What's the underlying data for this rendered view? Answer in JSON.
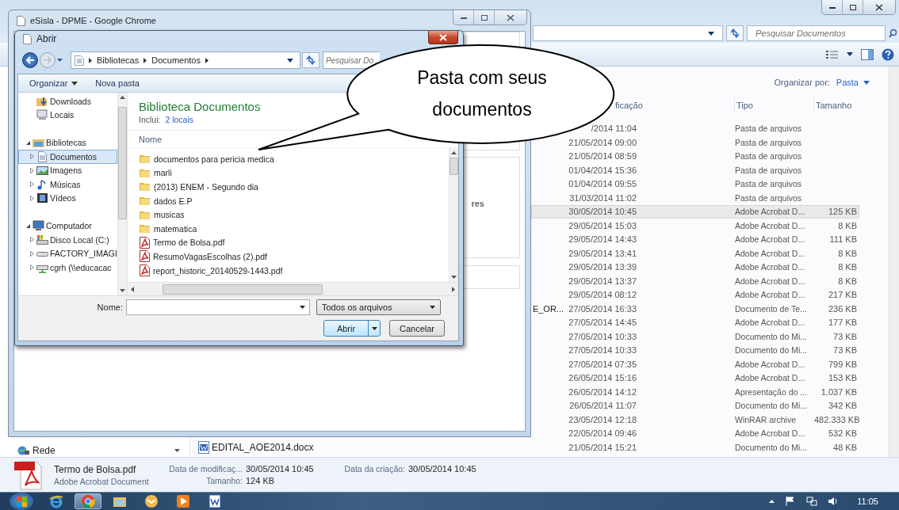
{
  "explorer": {
    "search": {
      "placeholder": "Pesquisar Documentos"
    },
    "arrange": {
      "label": "Organizar por:",
      "value": "Pasta"
    },
    "columns": [
      "ficação",
      "Tipo",
      "Tamanho"
    ],
    "rows": [
      {
        "date": "/2014 11:04",
        "type": "Pasta de arquivos",
        "selected": false
      },
      {
        "date": "21/05/2014 09:00",
        "type": "Pasta de arquivos",
        "selected": false
      },
      {
        "date": "21/05/2014 08:59",
        "type": "Pasta de arquivos",
        "selected": false
      },
      {
        "date": "01/04/2014 15:36",
        "type": "Pasta de arquivos",
        "selected": false
      },
      {
        "date": "01/04/2014 09:55",
        "type": "Pasta de arquivos",
        "selected": false
      },
      {
        "date": "31/03/2014 11:02",
        "type": "Pasta de arquivos",
        "selected": false
      },
      {
        "date": "30/05/2014 10:45",
        "type": "Adobe Acrobat D...",
        "size": "125 KB",
        "selected": true
      },
      {
        "date": "29/05/2014 15:03",
        "type": "Adobe Acrobat D...",
        "size": "8 KB",
        "selected": false
      },
      {
        "date": "29/05/2014 14:43",
        "type": "Adobe Acrobat D...",
        "size": "111 KB",
        "selected": false
      },
      {
        "date": "29/05/2014 13:41",
        "type": "Adobe Acrobat D...",
        "size": "8 KB",
        "selected": false
      },
      {
        "date": "29/05/2014 13:39",
        "type": "Adobe Acrobat D...",
        "size": "8 KB",
        "selected": false
      },
      {
        "date": "29/05/2014 13:37",
        "type": "Adobe Acrobat D...",
        "size": "8 KB",
        "selected": false
      },
      {
        "date": "29/05/2014 08:12",
        "type": "Adobe Acrobat D...",
        "size": "217 KB",
        "selected": false
      },
      {
        "name_tail": "E_OR...",
        "date": "27/05/2014 16:33",
        "type": "Documento de Te...",
        "size": "236 KB",
        "selected": false
      },
      {
        "date": "27/05/2014 14:45",
        "type": "Adobe Acrobat D...",
        "size": "177 KB",
        "selected": false
      },
      {
        "date": "27/05/2014 10:33",
        "type": "Documento do Mi...",
        "size": "73 KB",
        "selected": false
      },
      {
        "date": "27/05/2014 10:33",
        "type": "Documento do Mi...",
        "size": "73 KB",
        "selected": false
      },
      {
        "date": "27/05/2014 07:35",
        "type": "Adobe Acrobat D...",
        "size": "799 KB",
        "selected": false
      },
      {
        "date": "26/05/2014 15:16",
        "type": "Adobe Acrobat D...",
        "size": "153 KB",
        "selected": false
      },
      {
        "date": "26/05/2014 14:12",
        "type": "Apresentação do ...",
        "size": "1.037 KB",
        "selected": false
      },
      {
        "date": "26/05/2014 11:07",
        "type": "Documento do Mi...",
        "size": "342 KB",
        "selected": false
      },
      {
        "date": "23/05/2014 12:18",
        "type": "WinRAR archive",
        "size": "482.333 KB",
        "selected": false
      },
      {
        "date": "22/05/2014 09:46",
        "type": "Adobe Acrobat D...",
        "size": "532 KB",
        "selected": false
      },
      {
        "name": "EDITAL_AOE2014.docx",
        "date": "21/05/2014 15:21",
        "type": "Documento do Mi...",
        "size": "48 KB",
        "selected": false
      }
    ],
    "nav_bottom": {
      "label": "Rede"
    },
    "details": {
      "name": "Termo de Bolsa.pdf",
      "type": "Adobe Acrobat Document",
      "fields": [
        {
          "label": "Data de modificaç...",
          "value": "30/05/2014 10:45"
        },
        {
          "label": "Tamanho:",
          "value": "124 KB"
        },
        {
          "label": "Data da criação:",
          "value": "30/05/2014 10:45"
        }
      ]
    }
  },
  "chrome": {
    "title": "eSisla - DPME - Google Chrome",
    "page_fragment": "res"
  },
  "dialog": {
    "title": "Abrir",
    "path": [
      "Bibliotecas",
      "Documentos"
    ],
    "search": {
      "placeholder": "Pesquisar Do"
    },
    "toolbar": [
      {
        "label": "Organizar",
        "menu": true
      },
      {
        "label": "Nova pasta",
        "menu": false
      }
    ],
    "nav": [
      {
        "children": [
          {
            "label": "Downloads",
            "kind": "downloads",
            "selected": false
          },
          {
            "label": "Locais",
            "kind": "places",
            "selected": false
          }
        ]
      },
      {
        "label": "Bibliotecas",
        "kind": "library",
        "expanded": true,
        "selected": false,
        "children": [
          {
            "label": "Documentos",
            "kind": "documents",
            "expanded": false,
            "selected": true
          },
          {
            "label": "Imagens",
            "kind": "images",
            "expanded": false,
            "selected": false
          },
          {
            "label": "Músicas",
            "kind": "music",
            "expanded": false,
            "selected": false
          },
          {
            "label": "Vídeos",
            "kind": "video",
            "expanded": false,
            "selected": false
          }
        ]
      },
      {
        "label": "Computador",
        "kind": "computer",
        "expanded": true,
        "selected": false,
        "children": [
          {
            "label": "Disco Local (C:)",
            "kind": "disk",
            "expanded": false,
            "selected": false
          },
          {
            "label": "FACTORY_IMAGI",
            "kind": "drive",
            "expanded": false,
            "selected": false
          },
          {
            "label": "cgrh (\\\\educacac",
            "kind": "netdrive",
            "expanded": false,
            "selected": false
          }
        ]
      }
    ],
    "library": {
      "title": "Biblioteca Documentos",
      "includes_label": "Inclui:",
      "includes_link": "2 locais"
    },
    "column": "Nome",
    "files": [
      {
        "name": "documentos para pericia medica",
        "kind": "folder"
      },
      {
        "name": "marli",
        "kind": "folder"
      },
      {
        "name": "(2013) ENEM - Segundo dia",
        "kind": "folder"
      },
      {
        "name": "dados E.P",
        "kind": "folder"
      },
      {
        "name": "musicas",
        "kind": "folder"
      },
      {
        "name": "matematica",
        "kind": "folder"
      },
      {
        "name": "Termo de Bolsa.pdf",
        "kind": "pdf"
      },
      {
        "name": "ResumoVagasEscolhas (2).pdf",
        "kind": "pdf"
      },
      {
        "name": "report_historic_20140529-1443.pdf",
        "kind": "pdf"
      }
    ],
    "filename": {
      "label": "Nome:"
    },
    "filter": "Todos os arquivos",
    "buttons": [
      {
        "label": "Abrir",
        "kind": "split"
      },
      {
        "label": "Cancelar",
        "kind": "plain"
      }
    ]
  },
  "callout": {
    "text": "Pasta com seus documentos"
  },
  "taskbar": {
    "apps": [
      {
        "kind": "ie",
        "active": false
      },
      {
        "kind": "chrome",
        "active": true
      },
      {
        "kind": "explorer",
        "active": false
      },
      {
        "kind": "outlook",
        "active": false
      },
      {
        "kind": "media",
        "active": false
      },
      {
        "kind": "word",
        "active": false
      }
    ],
    "clock": "11:05"
  }
}
